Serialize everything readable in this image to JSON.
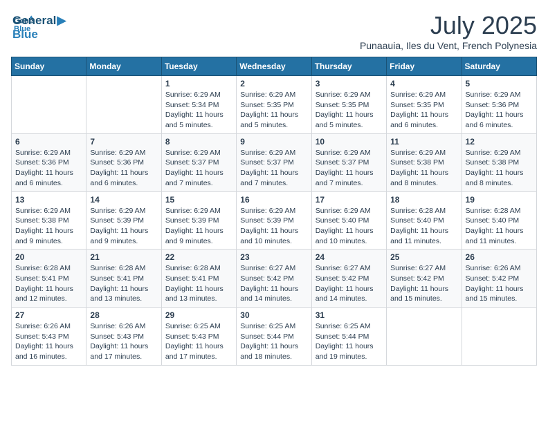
{
  "logo": {
    "line1": "General",
    "line2": "Blue"
  },
  "title": "July 2025",
  "subtitle": "Punaauia, Iles du Vent, French Polynesia",
  "days_of_week": [
    "Sunday",
    "Monday",
    "Tuesday",
    "Wednesday",
    "Thursday",
    "Friday",
    "Saturday"
  ],
  "weeks": [
    [
      {
        "day": "",
        "info": ""
      },
      {
        "day": "",
        "info": ""
      },
      {
        "day": "1",
        "info": "Sunrise: 6:29 AM\nSunset: 5:34 PM\nDaylight: 11 hours and 5 minutes."
      },
      {
        "day": "2",
        "info": "Sunrise: 6:29 AM\nSunset: 5:35 PM\nDaylight: 11 hours and 5 minutes."
      },
      {
        "day": "3",
        "info": "Sunrise: 6:29 AM\nSunset: 5:35 PM\nDaylight: 11 hours and 5 minutes."
      },
      {
        "day": "4",
        "info": "Sunrise: 6:29 AM\nSunset: 5:35 PM\nDaylight: 11 hours and 6 minutes."
      },
      {
        "day": "5",
        "info": "Sunrise: 6:29 AM\nSunset: 5:36 PM\nDaylight: 11 hours and 6 minutes."
      }
    ],
    [
      {
        "day": "6",
        "info": "Sunrise: 6:29 AM\nSunset: 5:36 PM\nDaylight: 11 hours and 6 minutes."
      },
      {
        "day": "7",
        "info": "Sunrise: 6:29 AM\nSunset: 5:36 PM\nDaylight: 11 hours and 6 minutes."
      },
      {
        "day": "8",
        "info": "Sunrise: 6:29 AM\nSunset: 5:37 PM\nDaylight: 11 hours and 7 minutes."
      },
      {
        "day": "9",
        "info": "Sunrise: 6:29 AM\nSunset: 5:37 PM\nDaylight: 11 hours and 7 minutes."
      },
      {
        "day": "10",
        "info": "Sunrise: 6:29 AM\nSunset: 5:37 PM\nDaylight: 11 hours and 7 minutes."
      },
      {
        "day": "11",
        "info": "Sunrise: 6:29 AM\nSunset: 5:38 PM\nDaylight: 11 hours and 8 minutes."
      },
      {
        "day": "12",
        "info": "Sunrise: 6:29 AM\nSunset: 5:38 PM\nDaylight: 11 hours and 8 minutes."
      }
    ],
    [
      {
        "day": "13",
        "info": "Sunrise: 6:29 AM\nSunset: 5:38 PM\nDaylight: 11 hours and 9 minutes."
      },
      {
        "day": "14",
        "info": "Sunrise: 6:29 AM\nSunset: 5:39 PM\nDaylight: 11 hours and 9 minutes."
      },
      {
        "day": "15",
        "info": "Sunrise: 6:29 AM\nSunset: 5:39 PM\nDaylight: 11 hours and 9 minutes."
      },
      {
        "day": "16",
        "info": "Sunrise: 6:29 AM\nSunset: 5:39 PM\nDaylight: 11 hours and 10 minutes."
      },
      {
        "day": "17",
        "info": "Sunrise: 6:29 AM\nSunset: 5:40 PM\nDaylight: 11 hours and 10 minutes."
      },
      {
        "day": "18",
        "info": "Sunrise: 6:28 AM\nSunset: 5:40 PM\nDaylight: 11 hours and 11 minutes."
      },
      {
        "day": "19",
        "info": "Sunrise: 6:28 AM\nSunset: 5:40 PM\nDaylight: 11 hours and 11 minutes."
      }
    ],
    [
      {
        "day": "20",
        "info": "Sunrise: 6:28 AM\nSunset: 5:41 PM\nDaylight: 11 hours and 12 minutes."
      },
      {
        "day": "21",
        "info": "Sunrise: 6:28 AM\nSunset: 5:41 PM\nDaylight: 11 hours and 13 minutes."
      },
      {
        "day": "22",
        "info": "Sunrise: 6:28 AM\nSunset: 5:41 PM\nDaylight: 11 hours and 13 minutes."
      },
      {
        "day": "23",
        "info": "Sunrise: 6:27 AM\nSunset: 5:42 PM\nDaylight: 11 hours and 14 minutes."
      },
      {
        "day": "24",
        "info": "Sunrise: 6:27 AM\nSunset: 5:42 PM\nDaylight: 11 hours and 14 minutes."
      },
      {
        "day": "25",
        "info": "Sunrise: 6:27 AM\nSunset: 5:42 PM\nDaylight: 11 hours and 15 minutes."
      },
      {
        "day": "26",
        "info": "Sunrise: 6:26 AM\nSunset: 5:42 PM\nDaylight: 11 hours and 15 minutes."
      }
    ],
    [
      {
        "day": "27",
        "info": "Sunrise: 6:26 AM\nSunset: 5:43 PM\nDaylight: 11 hours and 16 minutes."
      },
      {
        "day": "28",
        "info": "Sunrise: 6:26 AM\nSunset: 5:43 PM\nDaylight: 11 hours and 17 minutes."
      },
      {
        "day": "29",
        "info": "Sunrise: 6:25 AM\nSunset: 5:43 PM\nDaylight: 11 hours and 17 minutes."
      },
      {
        "day": "30",
        "info": "Sunrise: 6:25 AM\nSunset: 5:44 PM\nDaylight: 11 hours and 18 minutes."
      },
      {
        "day": "31",
        "info": "Sunrise: 6:25 AM\nSunset: 5:44 PM\nDaylight: 11 hours and 19 minutes."
      },
      {
        "day": "",
        "info": ""
      },
      {
        "day": "",
        "info": ""
      }
    ]
  ]
}
